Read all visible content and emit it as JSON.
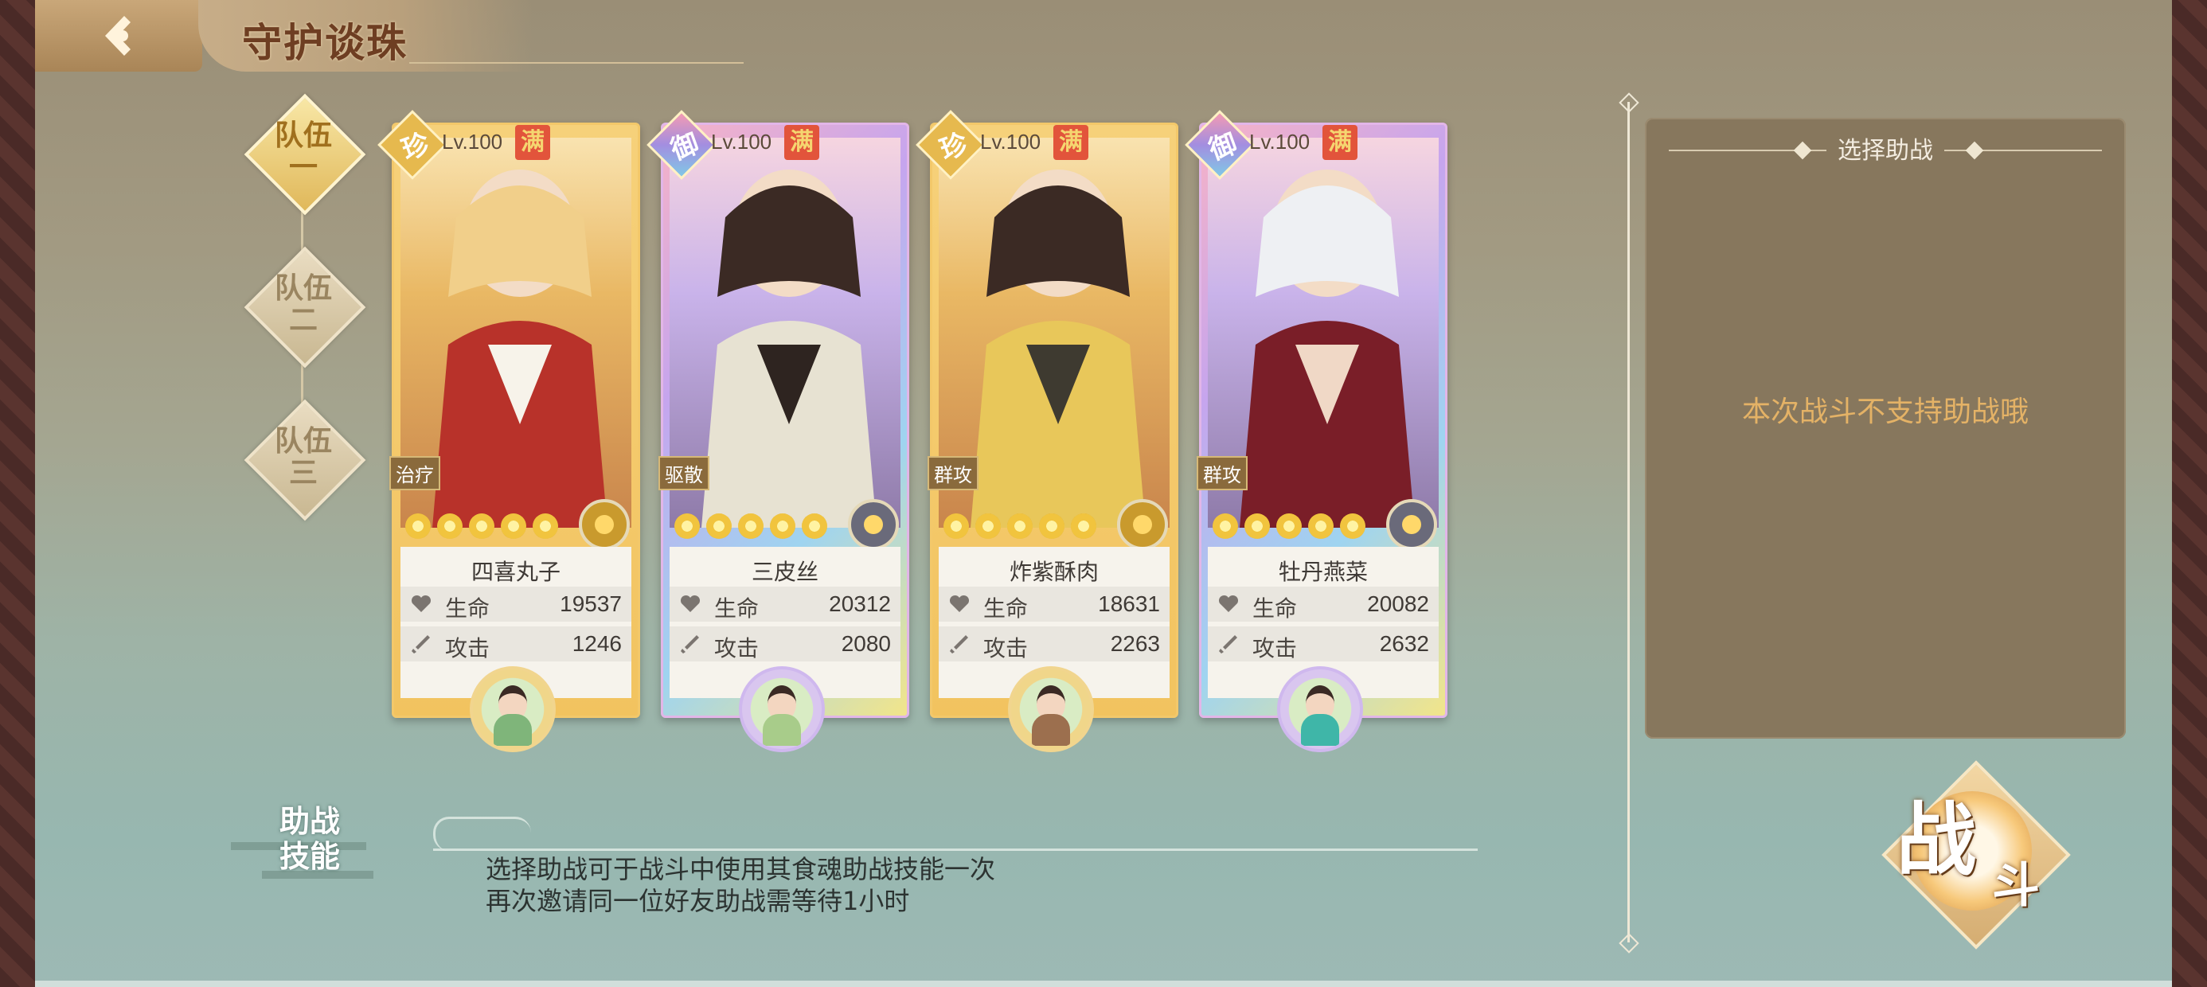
{
  "header": {
    "title": "守护谈珠"
  },
  "teams": [
    {
      "label_top": "队伍",
      "label_bottom": "一",
      "active": true
    },
    {
      "label_top": "队伍",
      "label_bottom": "二",
      "active": false
    },
    {
      "label_top": "队伍",
      "label_bottom": "三",
      "active": false
    }
  ],
  "stat_labels": {
    "hp": "生命",
    "atk": "攻击"
  },
  "cards": [
    {
      "rank": "珍",
      "level": "Lv.100",
      "full": "满",
      "role": "治疗",
      "name": "四喜丸子",
      "hp": "19537",
      "atk": "1246",
      "frame": "gold",
      "element": "gold",
      "stars": 5
    },
    {
      "rank": "御",
      "level": "Lv.100",
      "full": "满",
      "role": "驱散",
      "name": "三皮丝",
      "hp": "20312",
      "atk": "2080",
      "frame": "rainbow",
      "element": "dark",
      "stars": 5
    },
    {
      "rank": "珍",
      "level": "Lv.100",
      "full": "满",
      "role": "群攻",
      "name": "炸紫酥肉",
      "hp": "18631",
      "atk": "2263",
      "frame": "gold",
      "element": "gold",
      "stars": 5
    },
    {
      "rank": "御",
      "level": "Lv.100",
      "full": "满",
      "role": "群攻",
      "name": "牡丹燕菜",
      "hp": "20082",
      "atk": "2632",
      "frame": "rainbow",
      "element": "dark",
      "stars": 5
    }
  ],
  "assist_skill": {
    "title_top": "助战",
    "title_bottom": "技能",
    "desc_line1": "选择助战可于战斗中使用其食魂助战技能一次",
    "desc_line2": "再次邀请同一位好友助战需等待1小时"
  },
  "assist_panel": {
    "title": "选择助战",
    "message": "本次战斗不支持助战哦"
  },
  "battle_button": {
    "label_main": "战",
    "label_sub": "斗"
  },
  "colors": {
    "accent": "#e4b266",
    "panel": "#87775d"
  }
}
